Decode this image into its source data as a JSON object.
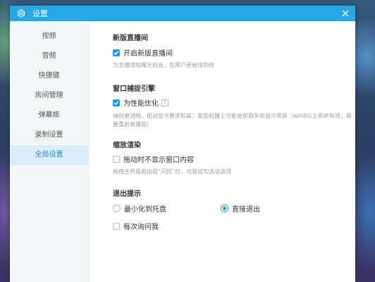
{
  "window": {
    "title": "设置",
    "close_icon": "close-icon",
    "app_icon": "gear-icon"
  },
  "sidebar": {
    "items": [
      {
        "label": "视频"
      },
      {
        "label": "音频"
      },
      {
        "label": "快捷键"
      },
      {
        "label": "房间管理"
      },
      {
        "label": "弹幕姬"
      },
      {
        "label": "录制设置"
      },
      {
        "label": "全局设置",
        "active": true
      }
    ]
  },
  "sections": {
    "new_live": {
      "title": "新版直播间",
      "option": "开启新版直播间",
      "option_checked": true,
      "hint": "为主播增加曝光机会，在用户更易找到你"
    },
    "capture": {
      "title": "窗口捕捉引擎",
      "option": "为性能优化",
      "option_checked": true,
      "help": "?",
      "hint": "捕捉更流畅，但对显卡要求较高；某些机器上可能会抓取失败显示黑屏（win8以上系统有效，需要重启直播姬）"
    },
    "scaling": {
      "title": "缩放渲染",
      "option": "拖动时不显示窗口内容",
      "option_checked": false,
      "hint": "拖拽主界面若出现“闪烁”时，可尝试勾选该选项"
    },
    "exit": {
      "title": "退出提示",
      "radio_minimize": "最小化到托盘",
      "radio_exit": "直接退出",
      "selected": "直接退出",
      "ask_every_time": "每次询问我",
      "ask_checked": false
    }
  },
  "colors": {
    "accent": "#1e9be6",
    "titlebar": "#26a8e6",
    "active_nav_bg": "#dcedfa"
  }
}
